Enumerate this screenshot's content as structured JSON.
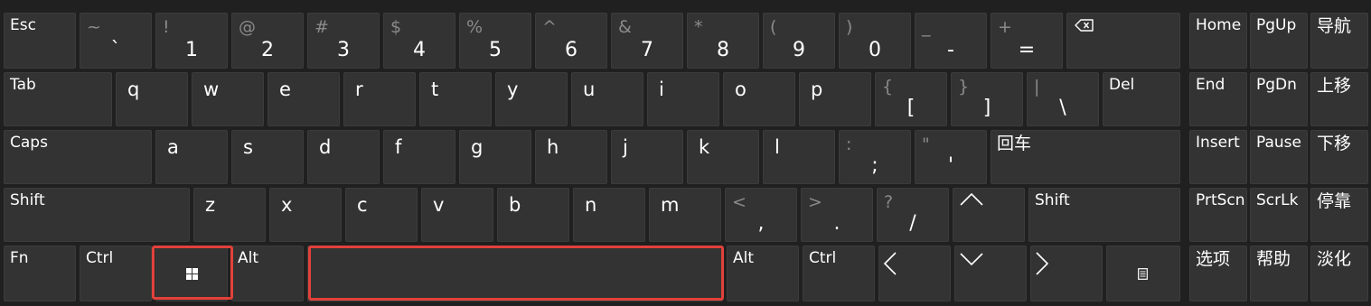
{
  "colors": {
    "key_bg": "#333333",
    "key_text": "#ffffff",
    "shift_text": "#8a8a8a",
    "highlight": "#e2413b",
    "background": "#202020"
  },
  "row1": {
    "esc": "Esc",
    "numbers": [
      {
        "shift": "~",
        "main": "`"
      },
      {
        "shift": "!",
        "main": "1"
      },
      {
        "shift": "@",
        "main": "2"
      },
      {
        "shift": "#",
        "main": "3"
      },
      {
        "shift": "$",
        "main": "4"
      },
      {
        "shift": "%",
        "main": "5"
      },
      {
        "shift": "^",
        "main": "6"
      },
      {
        "shift": "&",
        "main": "7"
      },
      {
        "shift": "*",
        "main": "8"
      },
      {
        "shift": "(",
        "main": "9"
      },
      {
        "shift": ")",
        "main": "0"
      },
      {
        "shift": "_",
        "main": "-"
      },
      {
        "shift": "+",
        "main": "="
      }
    ],
    "backspace_icon": "backspace-icon"
  },
  "row2": {
    "tab": "Tab",
    "letters": [
      "q",
      "w",
      "e",
      "r",
      "t",
      "y",
      "u",
      "i",
      "o",
      "p"
    ],
    "brackets": [
      {
        "shift": "{",
        "main": "["
      },
      {
        "shift": "}",
        "main": "]"
      },
      {
        "shift": "|",
        "main": "\\"
      }
    ],
    "del": "Del"
  },
  "row3": {
    "caps": "Caps",
    "letters": [
      "a",
      "s",
      "d",
      "f",
      "g",
      "h",
      "j",
      "k",
      "l"
    ],
    "punct": [
      {
        "shift": ":",
        "main": ";"
      },
      {
        "shift": "\"",
        "main": "'"
      }
    ],
    "enter": "回车"
  },
  "row4": {
    "shift_left": "Shift",
    "letters": [
      "z",
      "x",
      "c",
      "v",
      "b",
      "n",
      "m"
    ],
    "punct": [
      {
        "shift": "<",
        "main": ","
      },
      {
        "shift": ">",
        "main": "."
      },
      {
        "shift": "?",
        "main": "/"
      }
    ],
    "shift_right": "Shift"
  },
  "row5": {
    "fn": "Fn",
    "ctrl_left": "Ctrl",
    "win_icon": "windows-icon",
    "alt_left": "Alt",
    "alt_right": "Alt",
    "ctrl_right": "Ctrl",
    "menu_icon": "menu-icon"
  },
  "side": {
    "rows": [
      [
        "Home",
        "PgUp",
        "导航"
      ],
      [
        "End",
        "PgDn",
        "上移"
      ],
      [
        "Insert",
        "Pause",
        "下移"
      ],
      [
        "PrtScn",
        "ScrLk",
        "停靠"
      ],
      [
        "选项",
        "帮助",
        "淡化"
      ]
    ]
  }
}
